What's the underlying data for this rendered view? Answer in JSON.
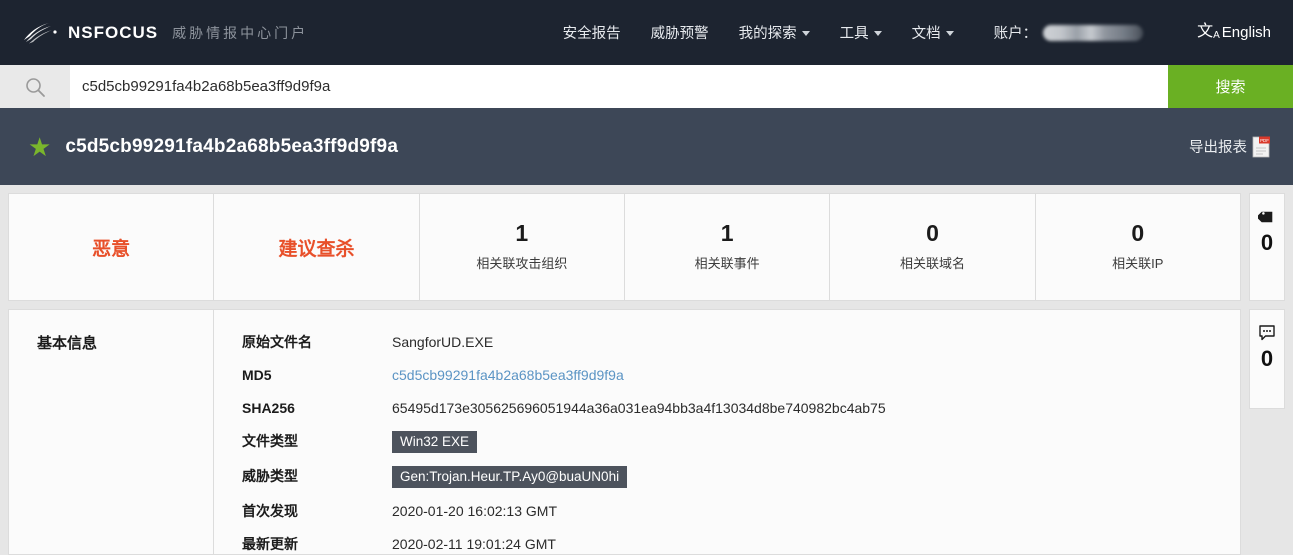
{
  "header": {
    "logo_icon": "nsfocus-wing-logo",
    "brand": "NSFOCUS",
    "brand_sub": "威胁情报中心门户",
    "nav": [
      {
        "label": "安全报告",
        "has_caret": false
      },
      {
        "label": "威胁预警",
        "has_caret": false
      },
      {
        "label": "我的探索",
        "has_caret": true
      },
      {
        "label": "工具",
        "has_caret": true
      },
      {
        "label": "文档",
        "has_caret": true
      }
    ],
    "account_label": "账户：",
    "account_value": "",
    "language": "English",
    "language_icon": "translate-icon"
  },
  "search": {
    "icon": "search-icon",
    "value": "c5d5cb99291fa4b2a68b5ea3ff9d9f9a",
    "placeholder": "",
    "button_label": "搜索",
    "button_color": "#6ab023"
  },
  "title_band": {
    "star_icon": "star-icon",
    "star_color": "#7ab62c",
    "hash": "c5d5cb99291fa4b2a68b5ea3ff9d9f9a",
    "export_label": "导出报表",
    "export_icon": "pdf-icon",
    "background": "#3d4757"
  },
  "summary": {
    "verdict_color": "#e8502a",
    "cells": [
      {
        "type": "verdict",
        "text": "恶意"
      },
      {
        "type": "verdict",
        "text": "建议查杀"
      },
      {
        "type": "metric",
        "value": "1",
        "label": "相关联攻击组织"
      },
      {
        "type": "metric",
        "value": "1",
        "label": "相关联事件"
      },
      {
        "type": "metric",
        "value": "0",
        "label": "相关联域名"
      },
      {
        "type": "metric",
        "value": "0",
        "label": "相关联IP"
      }
    ]
  },
  "basic_info": {
    "section_title": "基本信息",
    "rows": [
      {
        "label": "原始文件名",
        "value": "SangforUD.EXE",
        "style": "text"
      },
      {
        "label": "MD5",
        "value": "c5d5cb99291fa4b2a68b5ea3ff9d9f9a",
        "style": "link"
      },
      {
        "label": "SHA256",
        "value": "65495d173e305625696051944a36a031ea94bb3a4f13034d8be740982bc4ab75",
        "style": "text"
      },
      {
        "label": "文件类型",
        "value": "Win32 EXE",
        "style": "badge"
      },
      {
        "label": "威胁类型",
        "value": "Gen:Trojan.Heur.TP.Ay0@buaUN0hi",
        "style": "badge"
      },
      {
        "label": "首次发现",
        "value": "2020-01-20 16:02:13 GMT",
        "style": "text"
      },
      {
        "label": "最新更新",
        "value": "2020-02-11 19:01:24 GMT",
        "style": "text"
      }
    ]
  },
  "rail": {
    "tag": {
      "icon": "tag-icon",
      "count": "0"
    },
    "comment": {
      "icon": "comment-icon",
      "count": "0"
    }
  }
}
